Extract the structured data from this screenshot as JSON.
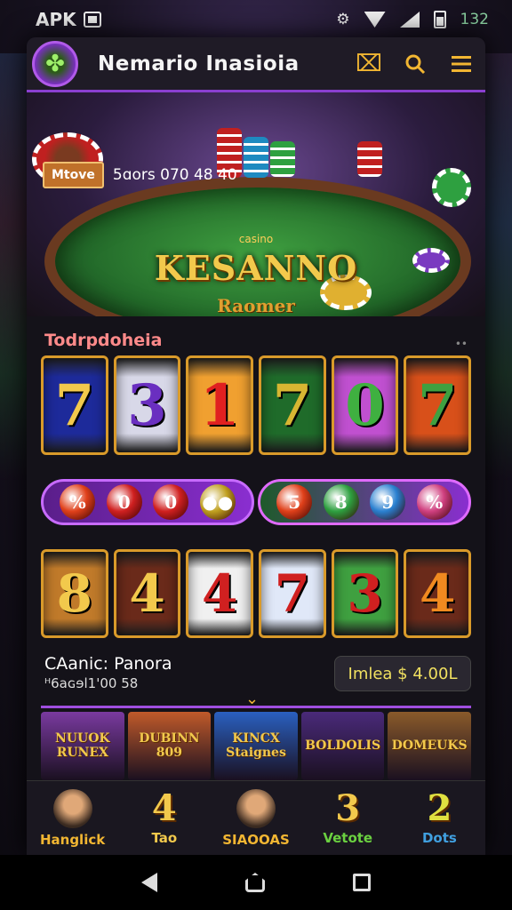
{
  "status_bar": {
    "left_text": "APK",
    "right_text": "132",
    "icons": [
      "app-notification-icon",
      "settings-gear-icon",
      "wifi-icon",
      "signal-icon",
      "battery-icon"
    ]
  },
  "app_bar": {
    "title": "Nemario Inasioia",
    "logo_icon": "leaf-logo-icon",
    "actions": [
      "close-frame-icon",
      "search-icon",
      "menu-icon"
    ]
  },
  "hero": {
    "tag": "Mtove",
    "banner_text": "5ɑors  070  48  40",
    "small_text": "casino",
    "brand": "KESANNO",
    "subbrand": "Raomer"
  },
  "section": {
    "title": "Todrpdoheia",
    "dots": "••"
  },
  "reels_top": [
    {
      "symbol": "7",
      "color": "#f2c94c",
      "bg": "#1d2a9a"
    },
    {
      "symbol": "3",
      "color": "#6a2fc0",
      "bg": "#d8d8e8"
    },
    {
      "symbol": "1",
      "color": "#e02020",
      "bg": "#f0a030"
    },
    {
      "symbol": "7",
      "color": "#d7b632",
      "bg": "#1f6b2a"
    },
    {
      "symbol": "0",
      "color": "#3fb040",
      "bg": "#c050d0"
    },
    {
      "symbol": "7",
      "color": "#3fa040",
      "bg": "#d8501a"
    }
  ],
  "pill_left": [
    "%",
    "0",
    "0",
    "●●"
  ],
  "pill_right": [
    "5",
    "8",
    "9",
    "%"
  ],
  "reels_bottom": [
    {
      "symbol": "8",
      "color": "#f2c94c",
      "bg": "#c07a2a"
    },
    {
      "symbol": "4",
      "color": "#f2c94c",
      "bg": "#6a2a1a"
    },
    {
      "symbol": "4",
      "color": "#d02020",
      "bg": "#f0f0f0"
    },
    {
      "symbol": "7",
      "color": "#d02020",
      "bg": "#e0e8f8"
    },
    {
      "symbol": "3",
      "color": "#d02020",
      "bg": "#3fa040"
    },
    {
      "symbol": "4",
      "color": "#f08a20",
      "bg": "#6a2a1a"
    }
  ],
  "casino_info": {
    "title": "CAanic: Panora",
    "subtitle": "ᴴ6aɢɘl1'00 58",
    "balance": "Imlea $ 4.00L"
  },
  "games": [
    {
      "label": "NUUOK RUNEX",
      "bg": "#7a3aa0"
    },
    {
      "label": "DUBINN 809",
      "bg": "#c05a2a"
    },
    {
      "label": "KINCX Staignes",
      "bg": "#2a60c0"
    },
    {
      "label": "BOLDOLIS",
      "bg": "#4a2a7a"
    },
    {
      "label": "DOMEUKS",
      "bg": "#8a5a2a"
    }
  ],
  "tabs": [
    {
      "big": "",
      "label": "Hanglick",
      "label_color": "#f2b632",
      "avatar": true
    },
    {
      "big": "4",
      "label": "Tao",
      "big_color": "#f2c94c",
      "label_color": "#f2c94c"
    },
    {
      "big": "",
      "label": "SIAOOAS",
      "label_color": "#f2b632",
      "avatar": true
    },
    {
      "big": "3",
      "label": "Vetote",
      "big_color": "#f2c94c",
      "label_color": "#6ad040"
    },
    {
      "big": "2",
      "label": "Dots",
      "big_color": "#e0e040",
      "label_color": "#40a0e0"
    }
  ],
  "nav": [
    "back-icon",
    "home-icon",
    "recent-apps-icon"
  ]
}
